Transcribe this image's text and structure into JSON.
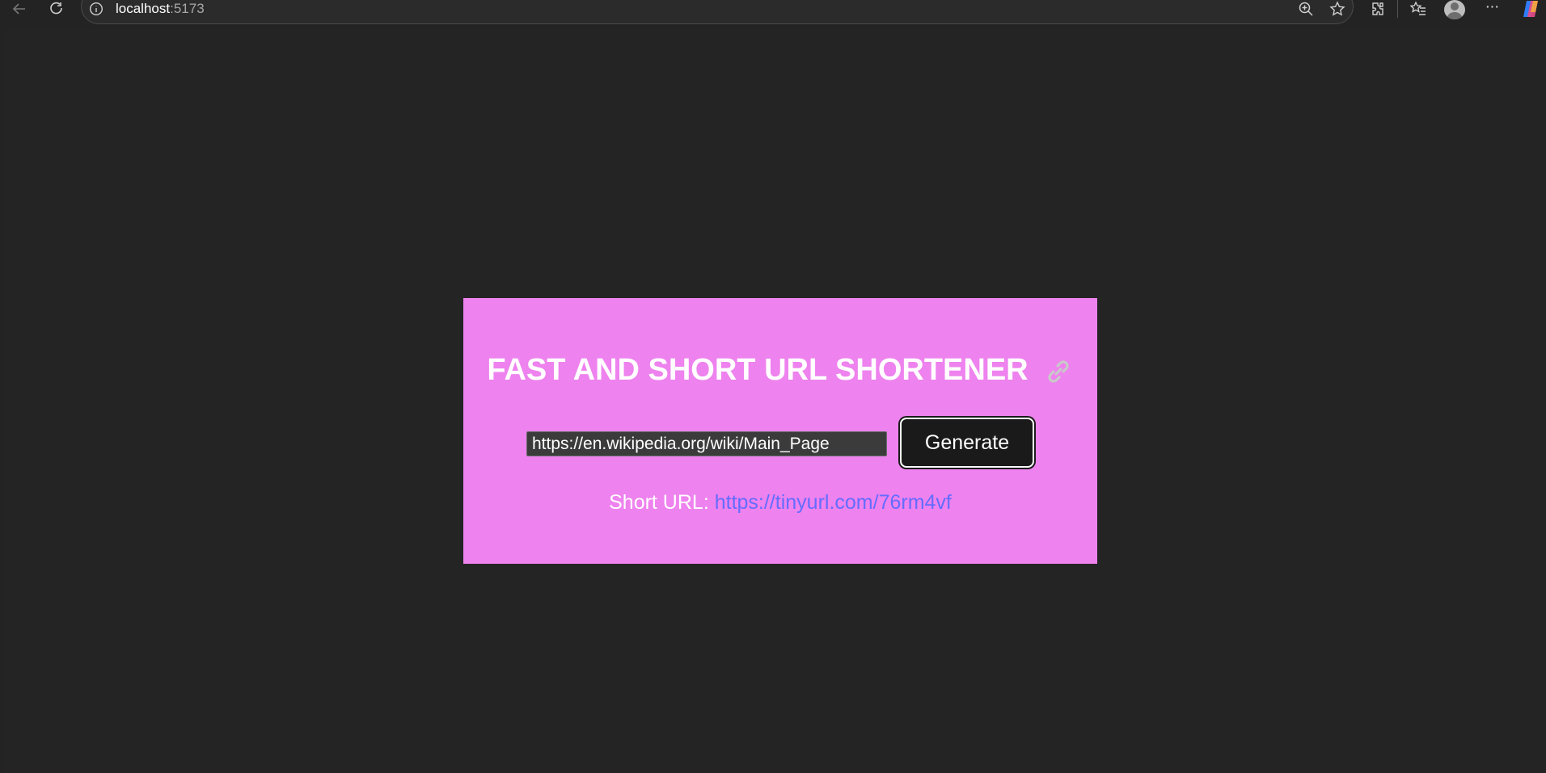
{
  "browser": {
    "url_host": "localhost",
    "url_port": ":5173",
    "icons": [
      "back-icon",
      "reload-icon",
      "info-icon",
      "zoom-icon",
      "star-icon",
      "extensions-icon",
      "favorites-icon",
      "profile-icon",
      "more-icon",
      "copilot-icon"
    ]
  },
  "app": {
    "title": "FAST AND SHORT URL SHORTENER",
    "title_emoji": "link-icon",
    "input_value": "https://en.wikipedia.org/wiki/Main_Page",
    "generate_label": "Generate",
    "short_url_label": "Short URL: ",
    "short_url": "https://tinyurl.com/76rm4vf"
  },
  "colors": {
    "page_bg": "#242424",
    "card_bg": "#ee82ee",
    "button_bg": "#1a1a1a",
    "link_color": "#646cff"
  }
}
